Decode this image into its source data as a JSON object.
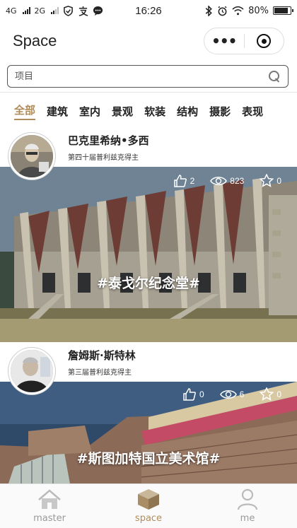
{
  "status_bar": {
    "network_1": "4G",
    "network_2": "2G",
    "time": "16:26",
    "battery": "80%"
  },
  "nav": {
    "title": "Space",
    "more_icon": "more-dots-icon",
    "close_icon": "target-icon"
  },
  "search": {
    "placeholder": "项目",
    "icon": "search-icon"
  },
  "tabs": [
    {
      "label": "全部",
      "active": true
    },
    {
      "label": "建筑"
    },
    {
      "label": "室内"
    },
    {
      "label": "景观"
    },
    {
      "label": "软装"
    },
    {
      "label": "结构"
    },
    {
      "label": "摄影"
    },
    {
      "label": "表现"
    }
  ],
  "cards": [
    {
      "architect": "巴克里希纳•多西",
      "award": "第四十届普利兹克得主",
      "project": "#泰戈尔纪念堂#",
      "likes": "2",
      "views": "823",
      "favorites": "0"
    },
    {
      "architect": "詹姆斯·斯特林",
      "award": "第三届普利兹克得主",
      "project": "#斯图加特国立美术馆#",
      "likes": "0",
      "views": "6",
      "favorites": "0"
    }
  ],
  "tabbar": [
    {
      "label": "master",
      "icon": "home-icon"
    },
    {
      "label": "space",
      "icon": "box-icon",
      "active": true
    },
    {
      "label": "me",
      "icon": "person-icon"
    }
  ],
  "colors": {
    "accent": "#b08c5a"
  }
}
